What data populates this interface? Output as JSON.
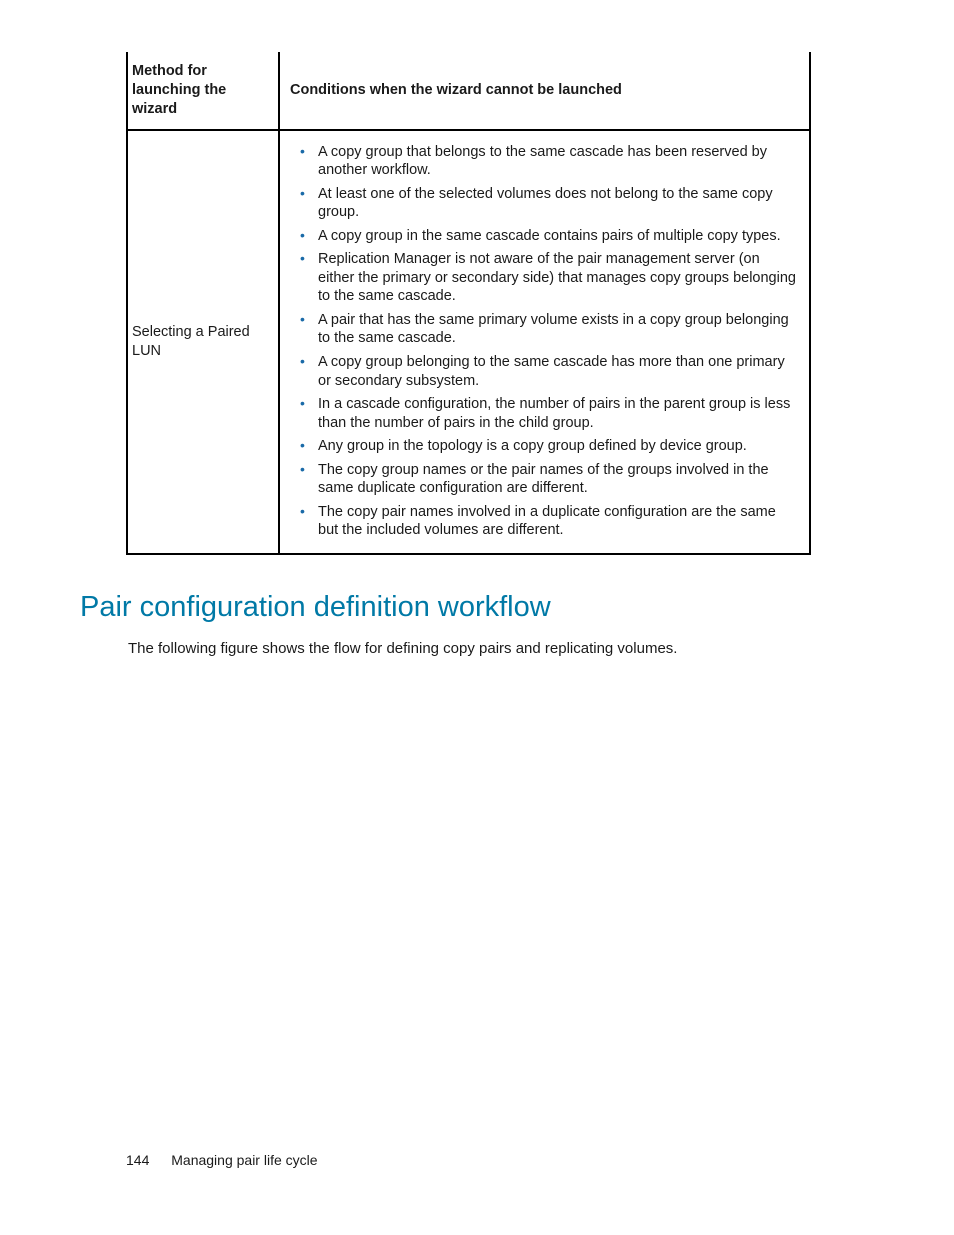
{
  "table": {
    "head": {
      "col1": "Method for launching the wizard",
      "col2": "Conditions when the wizard cannot be launched"
    },
    "row": {
      "method": "Selecting a Paired LUN",
      "items": [
        "A copy group that belongs to the same cascade has been reserved by another workflow.",
        "At least one of the selected volumes does not belong to the same copy group.",
        "A copy group in the same cascade contains pairs of multiple copy types.",
        "Replication Manager is not aware of the pair management server (on either the primary or secondary side) that manages copy groups belonging to the same cascade.",
        "A pair that has the same primary volume exists in a copy group belonging to the same cascade.",
        "A copy group belonging to the same cascade has more than one primary or secondary subsystem.",
        "In a cascade configuration, the number of pairs in the parent group is less than the number of pairs in the child group.",
        "Any group in the topology is a copy group defined by device group.",
        "The copy group names or the pair names of the groups involved in the same duplicate configuration are different.",
        "The copy pair names involved in a duplicate configuration are the same but the included volumes are different."
      ]
    }
  },
  "section_heading": "Pair configuration definition workflow",
  "section_intro": "The following figure shows the flow for defining copy pairs and replicating volumes.",
  "footer": {
    "page_number": "144",
    "chapter": "Managing pair life cycle"
  }
}
